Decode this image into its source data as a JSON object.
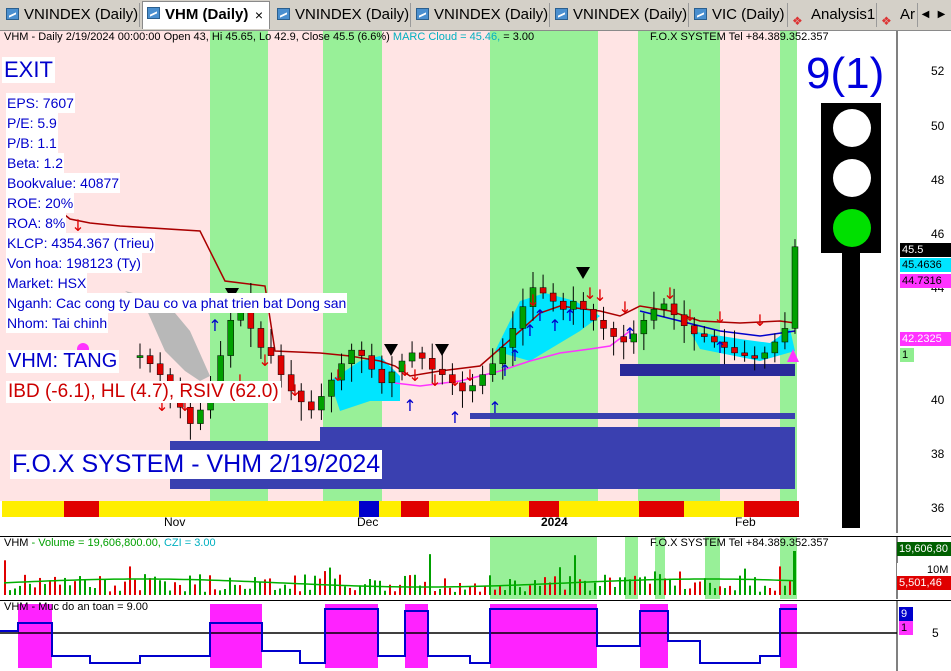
{
  "tabs": [
    {
      "label": "VNINDEX (Daily)",
      "icon": "chart-icon",
      "active": false
    },
    {
      "label": "VHM (Daily)",
      "icon": "chart-icon",
      "active": true,
      "close": "×"
    },
    {
      "label": "VNINDEX (Daily)",
      "icon": "chart-icon",
      "active": false
    },
    {
      "label": "VNINDEX (Daily)",
      "icon": "chart-icon",
      "active": false
    },
    {
      "label": "VNINDEX (Daily)",
      "icon": "chart-icon",
      "active": false
    },
    {
      "label": "VIC (Daily)",
      "icon": "chart-icon",
      "active": false
    },
    {
      "label": "Analysis1",
      "icon": "analysis-icon",
      "active": false
    },
    {
      "label": "Ar",
      "icon": "analysis-icon",
      "active": false
    }
  ],
  "price_pane": {
    "header": "VHM - Daily 2/19/2024 00:00:00 Open 43, Hi 45.65, Lo 42.9, Close 45.5 (6.6%)",
    "marc_cloud": "MARC Cloud = 45.46,",
    "eq": "= 3.00",
    "contact": "F.O.X SYSTEM Tel +84.389.352.357",
    "exit_label": "EXIT",
    "fundamentals": [
      "EPS: 7607",
      "P/E: 5.9",
      "P/B: 1.1",
      "Beta: 1.2",
      "Bookvalue: 40877",
      "ROE: 20%",
      "ROA: 8%",
      "KLCP: 4354.367 (Trieu)",
      "Von hoa: 198123 (Ty)",
      "Market: HSX",
      "Nganh: Cac cong ty Dau co va phat trien bat Dong san",
      "Nhom: Tai chinh"
    ],
    "status": "VHM: TANG",
    "indicators": "IBD (-6.1), HL (4.7), RSIV (62.0)",
    "brand": "F.O.X SYSTEM - VHM 2/19/2024",
    "signal_count": "9(1)",
    "y_ticks": [
      "52",
      "50",
      "48",
      "46",
      "44",
      "42",
      "40",
      "38",
      "36"
    ],
    "x_labels": [
      "Nov",
      "Dec",
      "2024",
      "Feb"
    ],
    "price_labels": [
      {
        "text": "45.5",
        "bg": "#000000",
        "fg": "#ffffff"
      },
      {
        "text": "45.4636",
        "bg": "#00e5ff",
        "fg": "#000000"
      },
      {
        "text": "44.7316",
        "bg": "#ff33ff",
        "fg": "#000000"
      },
      {
        "text": "42.2325",
        "bg": "#ff33ff",
        "fg": "#ffffff"
      },
      {
        "text": "1",
        "bg": "#90ee90",
        "fg": "#000000"
      }
    ],
    "colors": {
      "up": "#00a000",
      "down": "#e00000",
      "resistance": "#aa0000",
      "support": "#2a2a9a",
      "cloud": "#00e5ff",
      "green_zone": "#90ee90",
      "pink_zone": "#ffe0e0"
    }
  },
  "volume_pane": {
    "header_name": "VHM",
    "header_volume": "- Volume = 19,606,800.00,",
    "header_czi": "CZI = 3.00",
    "contact": "F.O.X SYSTEM Tel +84.389.352.357",
    "labels": [
      {
        "text": "19,606,80",
        "bg": "#006000",
        "fg": "#ffffff"
      },
      {
        "text": "10M",
        "bg": "#ffffff",
        "fg": "#000000"
      },
      {
        "text": "5,501,46",
        "bg": "#e00000",
        "fg": "#ffffff"
      }
    ]
  },
  "safety_pane": {
    "header": "VHM - Muc do an toan = 9.00",
    "labels": [
      {
        "text": "9",
        "bg": "#0000cc",
        "fg": "#ffffff"
      },
      {
        "text": "1",
        "bg": "#ff33ff",
        "fg": "#000000"
      },
      {
        "text": "5",
        "bg": "#ffffff",
        "fg": "#000000"
      }
    ]
  }
}
